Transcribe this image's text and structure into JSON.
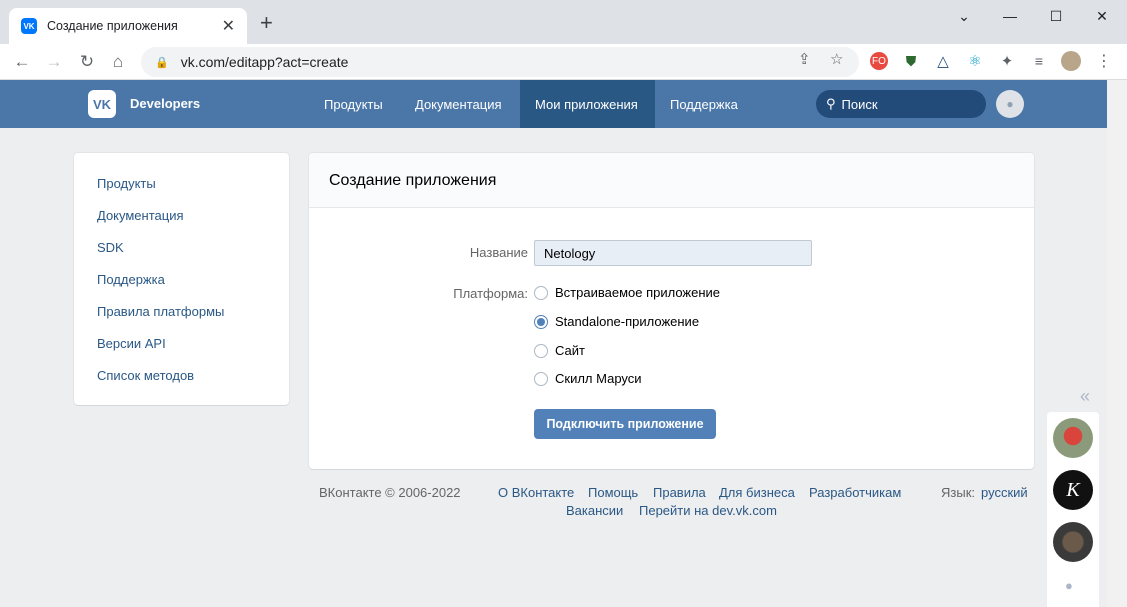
{
  "browser": {
    "tab_title": "Создание приложения",
    "tab_favicon": "VK",
    "url": "vk.com/editapp?act=create",
    "extensions": [
      "FO"
    ]
  },
  "vk_header": {
    "logo": "VK",
    "brand": "Developers",
    "nav": [
      "Продукты",
      "Документация",
      "Мои приложения",
      "Поддержка"
    ],
    "active_nav": "Мои приложения",
    "search_placeholder": "Поиск"
  },
  "side_menu": {
    "items": [
      "Продукты",
      "Документация",
      "SDK",
      "Поддержка",
      "Правила платформы",
      "Версии API",
      "Список методов"
    ]
  },
  "form": {
    "title": "Создание приложения",
    "name_label": "Название",
    "name_value": "Netology",
    "platform_label": "Платформа:",
    "platforms": [
      {
        "label": "Встраиваемое приложение",
        "checked": false
      },
      {
        "label": "Standalone-приложение",
        "checked": true
      },
      {
        "label": "Сайт",
        "checked": false
      },
      {
        "label": "Скилл Маруси",
        "checked": false
      }
    ],
    "submit_label": "Подключить приложение"
  },
  "footer": {
    "copyright": "ВКонтакте © 2006-2022",
    "links": [
      "О ВКонтакте",
      "Помощь",
      "Правила",
      "Для бизнеса",
      "Разработчикам"
    ],
    "links_row2": [
      "Вакансии",
      "Перейти на dev.vk.com"
    ],
    "language_label": "Язык:",
    "language_value": "русский"
  },
  "colors": {
    "vk_blue": "#4a76a8",
    "vk_active": "#2a5885",
    "link": "#2a5885",
    "button": "#5181b8",
    "page_bg": "#edeef0"
  }
}
